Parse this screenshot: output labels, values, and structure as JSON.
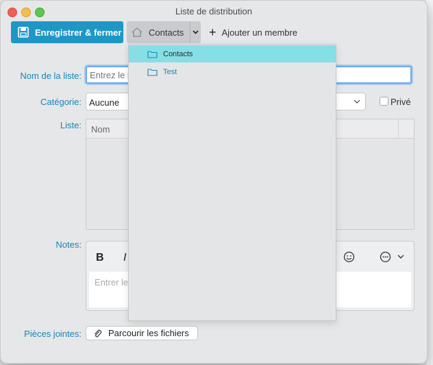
{
  "window": {
    "title": "Liste de distribution"
  },
  "toolbar": {
    "save_label": "Enregistrer & fermer",
    "contacts_label": "Contacts",
    "add_member_label": "Ajouter un membre"
  },
  "form": {
    "name_label": "Nom de la liste:",
    "name_placeholder": "Entrez le n",
    "category_label": "Catégorie:",
    "category_value": "Aucune",
    "private_label": "Privé",
    "list_label": "Liste:",
    "list_column": "Nom",
    "notes_label": "Notes:",
    "notes_bold": "B",
    "notes_italic": "I",
    "notes_placeholder": "Entrer les",
    "attachments_label": "Pièces jointes:",
    "browse_label": "Parcourir les fichiers"
  },
  "dropdown": {
    "items": [
      {
        "label": "Contacts",
        "selected": true
      },
      {
        "label": "Test",
        "selected": false
      }
    ]
  },
  "colors": {
    "accent": "#1f97c6",
    "selection": "#86dfe5",
    "label": "#1786b4"
  }
}
